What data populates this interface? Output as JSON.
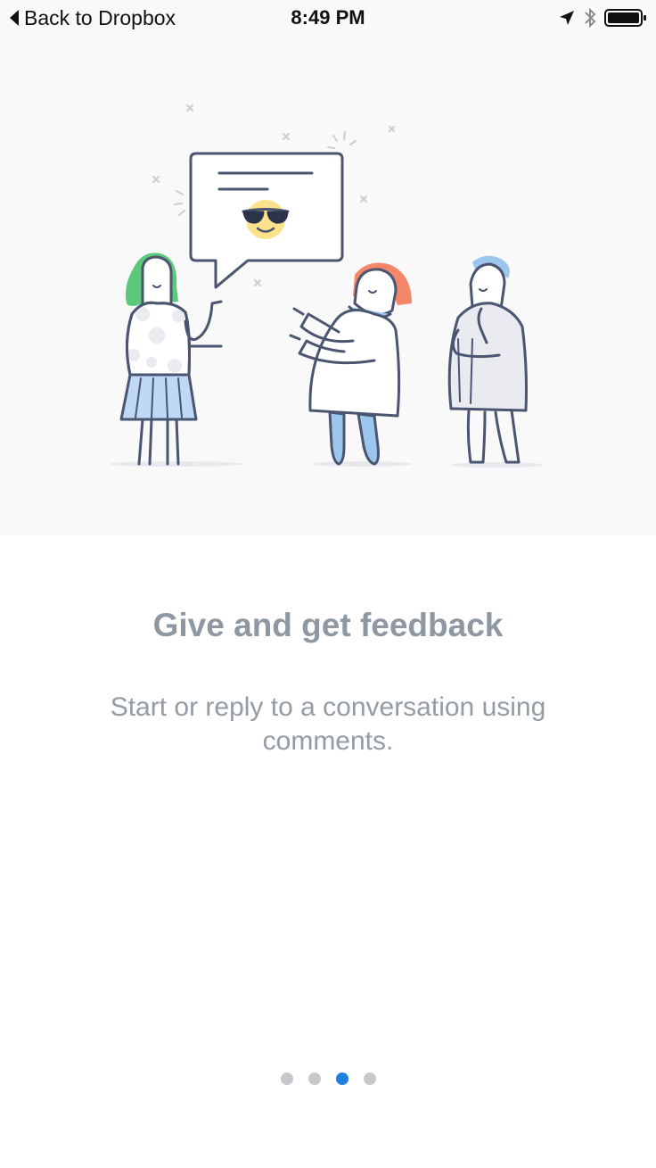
{
  "status_bar": {
    "back_label": "Back to Dropbox",
    "time": "8:49 PM",
    "icons": [
      "back-arrow-icon",
      "location-arrow-icon",
      "bluetooth-icon",
      "battery-icon"
    ]
  },
  "onboarding": {
    "title": "Give and get feedback",
    "description": "Start or reply to a conversation using comments.",
    "illustration": "three-people-conversation-with-speech-bubble",
    "emoji": "sunglasses-smiley-icon"
  },
  "pagination": {
    "total": 4,
    "current": 3
  },
  "colors": {
    "title": "#8e98a2",
    "description": "#939ca5",
    "active_dot": "#1f7fe0",
    "inactive_dot": "#c5c8cc",
    "illustration_bg": "#f9f9fa",
    "stroke": "#4a5570",
    "green_hair": "#5cc97a",
    "orange_hair": "#f4866a",
    "blue_hair": "#9cc6ee",
    "emoji_yellow": "#fbe28b"
  }
}
